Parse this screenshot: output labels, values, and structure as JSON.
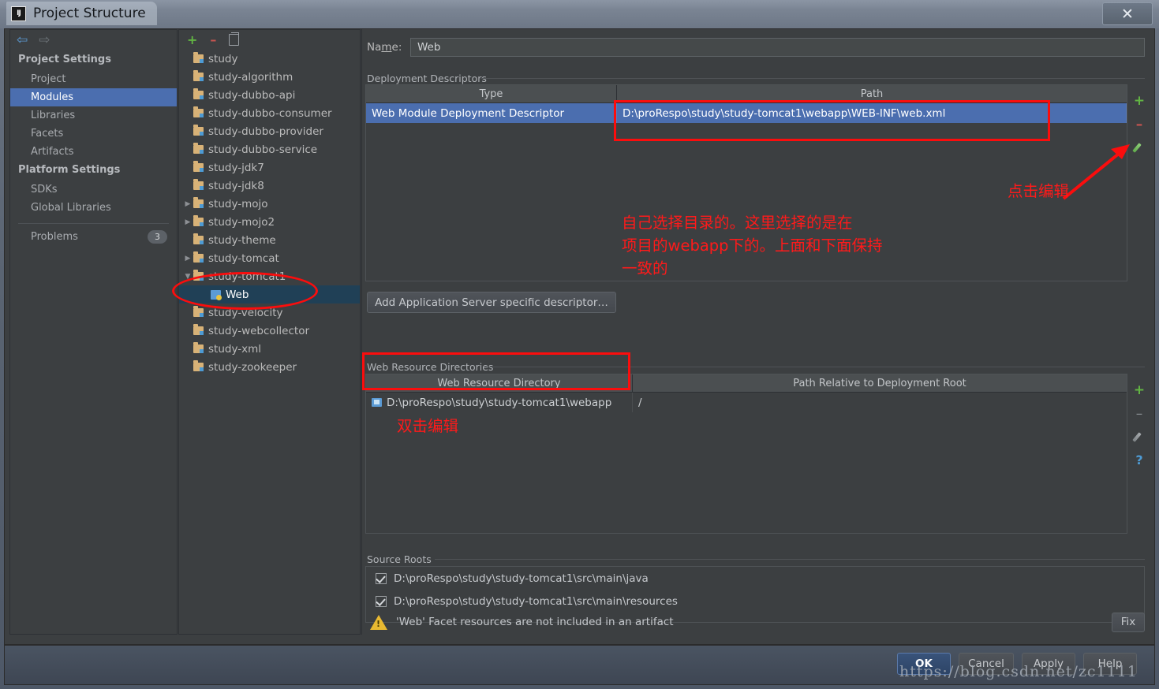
{
  "window": {
    "title": "Project Structure",
    "logo_text": "IJ",
    "close_label": "✕"
  },
  "sidebar": {
    "nav": {
      "back_icon": "⇦",
      "forward_icon": "⇨"
    },
    "groups": [
      {
        "label": "Project Settings",
        "items": [
          {
            "label": "Project",
            "selected": false
          },
          {
            "label": "Modules",
            "selected": true
          },
          {
            "label": "Libraries",
            "selected": false
          },
          {
            "label": "Facets",
            "selected": false
          },
          {
            "label": "Artifacts",
            "selected": false
          }
        ]
      },
      {
        "label": "Platform Settings",
        "items": [
          {
            "label": "SDKs",
            "selected": false
          },
          {
            "label": "Global Libraries",
            "selected": false
          }
        ]
      }
    ],
    "problems": {
      "label": "Problems",
      "count": "3"
    }
  },
  "tree": {
    "toolbar": {
      "add": "+",
      "remove": "–",
      "copy_icon": "copy-icon"
    },
    "nodes": [
      {
        "label": "study",
        "twisty": "",
        "indent": 0,
        "icon": "folder",
        "selected": false
      },
      {
        "label": "study-algorithm",
        "twisty": "",
        "indent": 0,
        "icon": "folder",
        "selected": false
      },
      {
        "label": "study-dubbo-api",
        "twisty": "",
        "indent": 0,
        "icon": "folder",
        "selected": false
      },
      {
        "label": "study-dubbo-consumer",
        "twisty": "",
        "indent": 0,
        "icon": "folder",
        "selected": false
      },
      {
        "label": "study-dubbo-provider",
        "twisty": "",
        "indent": 0,
        "icon": "folder",
        "selected": false
      },
      {
        "label": "study-dubbo-service",
        "twisty": "",
        "indent": 0,
        "icon": "folder",
        "selected": false
      },
      {
        "label": "study-jdk7",
        "twisty": "",
        "indent": 0,
        "icon": "folder",
        "selected": false
      },
      {
        "label": "study-jdk8",
        "twisty": "",
        "indent": 0,
        "icon": "folder",
        "selected": false
      },
      {
        "label": "study-mojo",
        "twisty": "▶",
        "indent": 0,
        "icon": "folder",
        "selected": false
      },
      {
        "label": "study-mojo2",
        "twisty": "▶",
        "indent": 0,
        "icon": "folder",
        "selected": false
      },
      {
        "label": "study-theme",
        "twisty": "",
        "indent": 0,
        "icon": "folder",
        "selected": false
      },
      {
        "label": "study-tomcat",
        "twisty": "▶",
        "indent": 0,
        "icon": "folder",
        "selected": false
      },
      {
        "label": "study-tomcat1",
        "twisty": "▼",
        "indent": 0,
        "icon": "folder",
        "selected": false
      },
      {
        "label": "Web",
        "twisty": "",
        "indent": 1,
        "icon": "web",
        "selected": true
      },
      {
        "label": "study-velocity",
        "twisty": "",
        "indent": 0,
        "icon": "folder",
        "selected": false
      },
      {
        "label": "study-webcollector",
        "twisty": "",
        "indent": 0,
        "icon": "folder",
        "selected": false
      },
      {
        "label": "study-xml",
        "twisty": "",
        "indent": 0,
        "icon": "folder",
        "selected": false
      },
      {
        "label": "study-zookeeper",
        "twisty": "",
        "indent": 0,
        "icon": "folder",
        "selected": false
      }
    ]
  },
  "facet": {
    "name_label": "Name:",
    "name_value": "Web",
    "deployment_descriptors": {
      "title": "Deployment Descriptors",
      "columns": [
        "Type",
        "Path"
      ],
      "rows": [
        {
          "type": "Web Module Deployment Descriptor",
          "path": "D:\\proRespo\\study\\study-tomcat1\\webapp\\WEB-INF\\web.xml",
          "selected": true
        }
      ],
      "toolbar": {
        "add": "+",
        "remove": "–",
        "edit": "edit-pencil-icon"
      }
    },
    "add_descriptor_button": "Add Application Server specific descriptor…",
    "web_resource_directories": {
      "title": "Web Resource Directories",
      "columns": [
        "Web Resource Directory",
        "Path Relative to Deployment Root"
      ],
      "rows": [
        {
          "directory": "D:\\proRespo\\study\\study-tomcat1\\webapp",
          "relative": "/"
        }
      ],
      "toolbar": {
        "add": "+",
        "remove": "–",
        "edit": "edit-pencil-icon",
        "help": "?"
      }
    },
    "source_roots": {
      "title": "Source Roots",
      "items": [
        {
          "path": "D:\\proRespo\\study\\study-tomcat1\\src\\main\\java",
          "checked": true
        },
        {
          "path": "D:\\proRespo\\study\\study-tomcat1\\src\\main\\resources",
          "checked": true
        }
      ]
    },
    "warning": {
      "text": "'Web' Facet resources are not included in an artifact",
      "fix_label": "Fix"
    }
  },
  "buttons": {
    "ok": "OK",
    "cancel": "Cancel",
    "apply": "Apply",
    "help": "Help"
  },
  "annotations": {
    "click_edit": "点击编辑",
    "choose_dir_line1": "自己选择目录的。这里选择的是在",
    "choose_dir_line2": "项目的webapp下的。上面和下面保持",
    "choose_dir_line3": "一致的",
    "double_click_edit": "双击编辑"
  },
  "watermark": "https://blog.csdn.net/zc1111",
  "colors": {
    "accent_selection": "#4b6eaf",
    "tree_selection": "#204056",
    "annotation_red": "#ff1a1a",
    "add_green": "#62b543",
    "remove_red": "#c75450",
    "warning_yellow": "#e8b931"
  }
}
